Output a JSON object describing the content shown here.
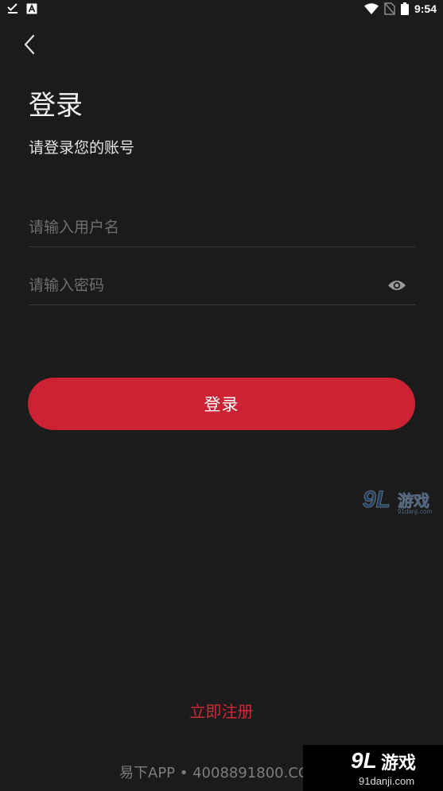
{
  "status_bar": {
    "time": "9:54",
    "left_icons": [
      "download-done-icon",
      "font-a-icon"
    ],
    "right_icons": [
      "wifi-icon",
      "no-sim-icon",
      "battery-icon"
    ]
  },
  "header": {
    "back_icon": "chevron-left-icon"
  },
  "page": {
    "title": "登录",
    "subtitle": "请登录您的账号"
  },
  "form": {
    "username": {
      "value": "",
      "placeholder": "请输入用户名"
    },
    "password": {
      "value": "",
      "placeholder": "请输入密码",
      "toggle_icon": "eye-icon"
    },
    "login_label": "登录"
  },
  "register_label": "立即注册",
  "footer": {
    "text": "易下APP • 4008891800.COM"
  },
  "watermark": {
    "logo_number": "9L",
    "logo_text": "游戏",
    "url": "91danji.com"
  },
  "colors": {
    "background": "#1b1b1c",
    "accent": "#cb2333",
    "register_link": "#d02a36",
    "placeholder": "#6e6e72",
    "divider": "#3a3a3c"
  }
}
